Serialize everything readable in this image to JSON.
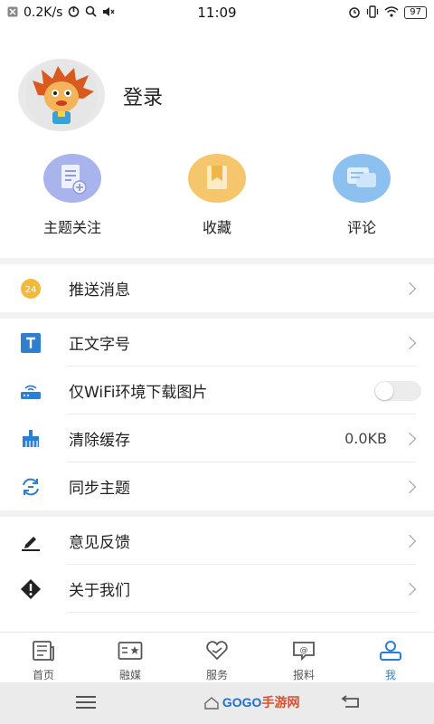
{
  "status_bar": {
    "speed": "0.2K/s",
    "time": "11:09",
    "battery": "97"
  },
  "profile": {
    "login_label": "登录"
  },
  "quick_actions": [
    {
      "label": "主题关注",
      "icon": "subscribe-doc-icon",
      "color": "#aab4ec"
    },
    {
      "label": "收藏",
      "icon": "bookmark-icon",
      "color": "#f5c66b"
    },
    {
      "label": "评论",
      "icon": "comment-icon",
      "color": "#8cc0ef"
    }
  ],
  "menu": {
    "push": {
      "label": "推送消息",
      "icon": "push-badge-icon"
    },
    "font_size": {
      "label": "正文字号",
      "icon": "text-size-icon"
    },
    "wifi_only": {
      "label": "仅WiFi环境下载图片",
      "icon": "router-icon",
      "enabled": false
    },
    "clear_cache": {
      "label": "清除缓存",
      "value": "0.0KB",
      "icon": "broom-icon"
    },
    "sync_topics": {
      "label": "同步主题",
      "icon": "sync-icon"
    },
    "feedback": {
      "label": "意见反馈",
      "icon": "pencil-icon"
    },
    "about": {
      "label": "关于我们",
      "icon": "warning-diamond-icon"
    }
  },
  "tabs": [
    {
      "label": "首页",
      "icon": "news-icon",
      "active": false
    },
    {
      "label": "融媒",
      "icon": "media-icon",
      "active": false
    },
    {
      "label": "服务",
      "icon": "heart-icon",
      "active": false
    },
    {
      "label": "报料",
      "icon": "report-icon",
      "active": false
    },
    {
      "label": "我",
      "icon": "profile-icon",
      "active": true
    }
  ],
  "nav": {
    "watermark_en": "GOGO",
    "watermark_cn": "手游网"
  },
  "colors": {
    "accent": "#2a7fd4",
    "divider": "#f2f2f2"
  }
}
